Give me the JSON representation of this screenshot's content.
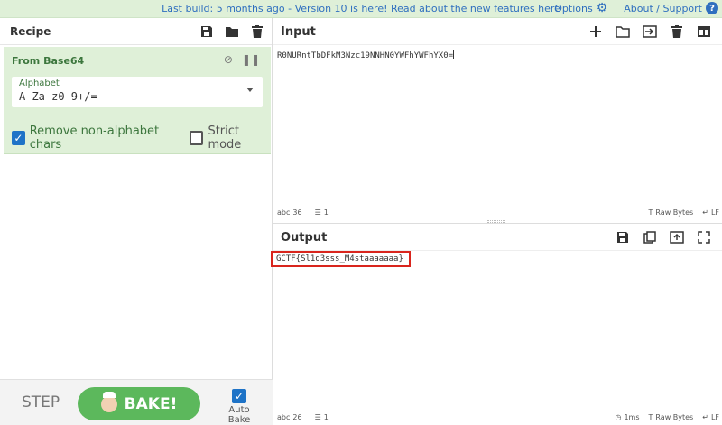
{
  "topbar": {
    "notice_link": "Last build: 5 months ago",
    "notice_sep": " - ",
    "notice_middle": "Version 10 is here! Read about the new features ",
    "notice_here": "here",
    "options": "Options",
    "about": "About / Support"
  },
  "recipe": {
    "title": "Recipe",
    "operation": {
      "name": "From Base64",
      "alphabet_label": "Alphabet",
      "alphabet_value": "A-Za-z0-9+/=",
      "remove_non_alphabet": "Remove non-alphabet chars",
      "remove_checked": true,
      "strict_mode": "Strict mode",
      "strict_checked": false
    },
    "step_label": "STEP",
    "bake_label": "BAKE!",
    "auto_bake_label": "Auto Bake",
    "auto_bake_checked": true
  },
  "input": {
    "title": "Input",
    "text": "R0NURntTbDFkM3Nzc19NNHN0YWFhYWFhYX0=",
    "status": {
      "chars_label": "abc",
      "chars": "36",
      "lines": "1",
      "raw_bytes": "Raw Bytes",
      "eol": "LF"
    }
  },
  "output": {
    "title": "Output",
    "text": "GCTF{Sl1d3sss_M4staaaaaaa}",
    "status": {
      "chars_label": "abc",
      "chars": "26",
      "lines": "1",
      "time": "1ms",
      "raw_bytes": "Raw Bytes",
      "eol": "LF"
    }
  },
  "colors": {
    "accent": "#2f6fbf",
    "op_bg": "#dff0d8",
    "op_text": "#3c763d",
    "bake_green": "#5cb85c",
    "highlight_red": "#d9251d"
  }
}
